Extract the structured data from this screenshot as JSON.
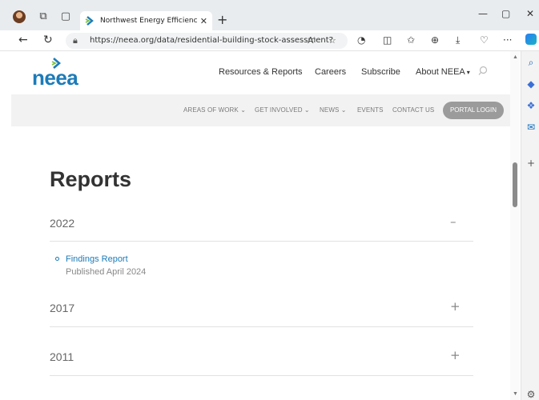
{
  "browser": {
    "tab_title": "Northwest Energy Efficiency Allia",
    "url": "https://neea.org/data/residential-building-stock-assessment?"
  },
  "site": {
    "logo_text": "neea",
    "brand_color": "#1c7bb8",
    "main_nav": [
      "Resources & Reports",
      "Careers",
      "Subscribe",
      "About NEEA"
    ],
    "sub_nav": [
      "AREAS OF WORK",
      "GET INVOLVED",
      "NEWS",
      "EVENTS",
      "CONTACT US"
    ],
    "portal_login": "PORTAL LOGIN"
  },
  "content": {
    "title": "Reports",
    "sections": [
      {
        "year": "2022",
        "expanded": true,
        "reports": [
          {
            "link": "Findings Report",
            "published": "Published April 2024"
          }
        ]
      },
      {
        "year": "2017",
        "expanded": false
      },
      {
        "year": "2011",
        "expanded": false
      }
    ]
  },
  "icons": {
    "back": "back-arrow-icon",
    "refresh": "refresh-icon",
    "lock": "lock-icon",
    "search": "search-icon",
    "settings": "gear-icon"
  }
}
